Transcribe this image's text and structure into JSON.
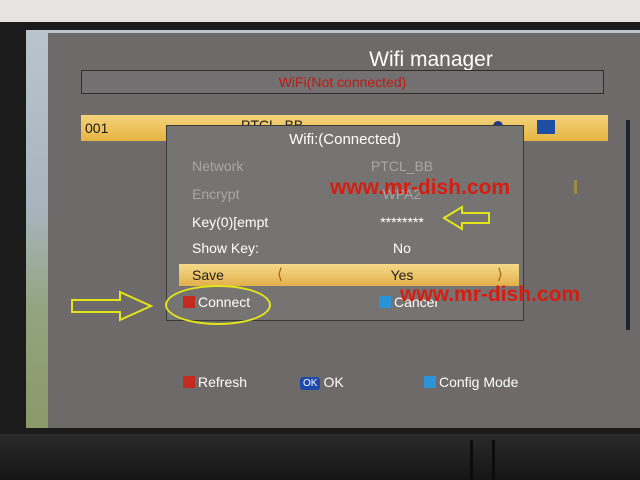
{
  "window_title": "Wifi manager",
  "status_text": "WiFi(Not connected)",
  "network_list": [
    {
      "index": "001",
      "ssid": "PTCL_BB"
    }
  ],
  "dialog": {
    "title": "Wifi:(Connected)",
    "network_label": "Network",
    "network_value": "PTCL_BB",
    "encrypt_label": "Encrypt",
    "encrypt_value": "WPA2",
    "key_label": "Key(0)[empt",
    "key_value": "********",
    "show_key_label": "Show Key:",
    "show_key_value": "No",
    "save_label": "Save",
    "save_value": "Yes",
    "connect_label": "Connect",
    "cancel_label": "Cancel"
  },
  "footer": {
    "refresh_label": "Refresh",
    "ok_key": "OK",
    "ok_label": "OK",
    "config_label": "Config Mode"
  },
  "watermark_1": "www.mr-dish.com",
  "watermark_2": "www.mr-dish.com",
  "colors": {
    "highlight": "#e6b442",
    "status_red": "#c21a12",
    "watermark_red": "#d81c10",
    "annotation_yellow": "#e2e51a",
    "key_red": "#c62a1e",
    "key_blue": "#2a92d6"
  }
}
